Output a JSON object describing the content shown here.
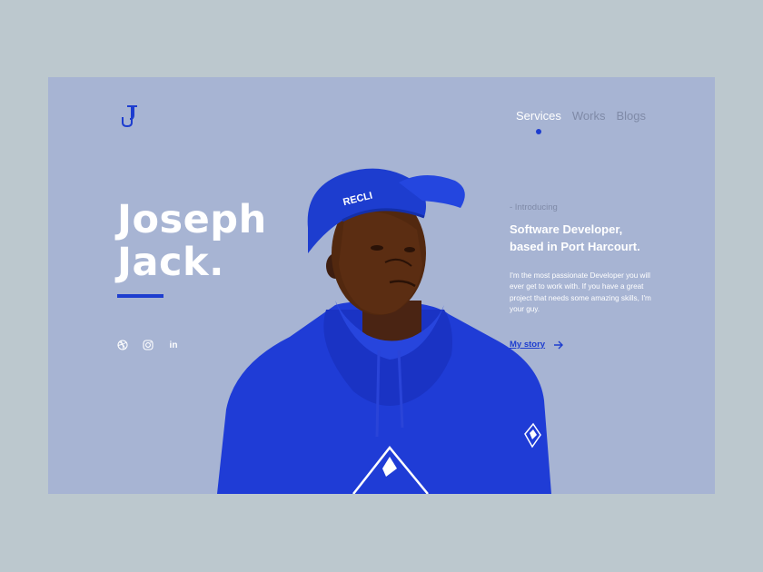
{
  "nav": {
    "items": [
      {
        "label": "Services",
        "active": true
      },
      {
        "label": "Works",
        "active": false
      },
      {
        "label": "Blogs",
        "active": false
      }
    ]
  },
  "hero": {
    "first_name": "Joseph",
    "last_name": "Jack.",
    "socials": [
      {
        "icon": "dribbble-icon"
      },
      {
        "icon": "instagram-icon"
      },
      {
        "icon": "linkedin-icon",
        "text": "in"
      }
    ]
  },
  "intro": {
    "tag": "- Introducing",
    "headline_line1": "Software Developer,",
    "headline_line2": "based in Port Harcourt.",
    "description": "I'm the most passionate Developer you will ever get to work with. If you have a great project that needs some amazing skills, I'm your guy.",
    "cta_label": "My story",
    "cta_icon": "arrow-right-icon"
  },
  "portrait": {
    "cap_text": "RECLI"
  },
  "colors": {
    "page_bg": "#bcc8ce",
    "card_bg": "#a7b4d3",
    "accent": "#1d3dcf",
    "muted": "#7f8aa7",
    "text": "#ffffff"
  }
}
